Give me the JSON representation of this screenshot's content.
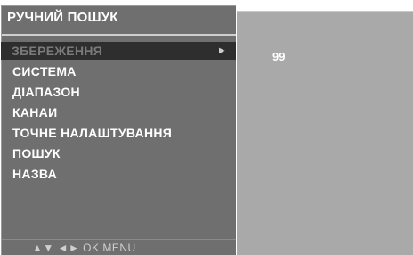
{
  "menu": {
    "title": "РУЧНИЙ ПОШУК",
    "items": [
      {
        "label": "ЗБЕРЕЖЕННЯ",
        "selected": true
      },
      {
        "label": "СИСТЕМА",
        "selected": false
      },
      {
        "label": "ДІАПАЗОН",
        "selected": false
      },
      {
        "label": "КАНАИ",
        "selected": false
      },
      {
        "label": "ТОЧНЕ НАЛАШТУВАННЯ",
        "selected": false
      },
      {
        "label": "ПОШУК",
        "selected": false
      },
      {
        "label": "НАЗВА",
        "selected": false
      }
    ],
    "selected_arrow": "►",
    "hint": "▲▼ ◄► OK MENU"
  },
  "submenu": {
    "value": "99"
  },
  "colors": {
    "menu_bg": "#6f6f6f",
    "selected_bg": "#2e2e2e",
    "submenu_bg": "#a9a9a9",
    "text": "#ffffff"
  }
}
